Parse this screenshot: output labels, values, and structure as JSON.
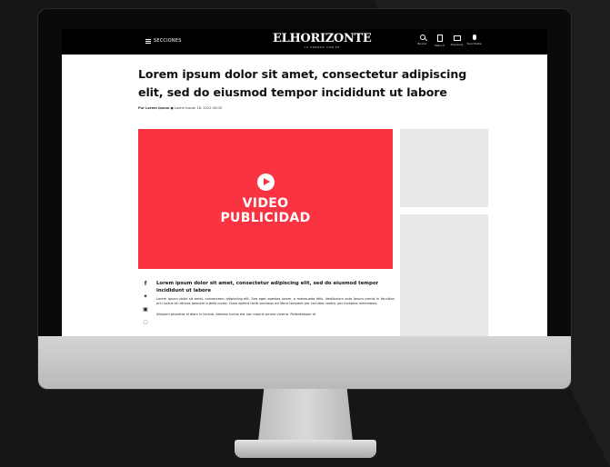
{
  "header": {
    "sections_label": "SECCIONES",
    "logo": "ELHORIZONTE",
    "logo_tagline": "LA VERDAD CON FE",
    "actions": [
      {
        "icon": "search-icon",
        "label": "Buscar"
      },
      {
        "icon": "newspaper-icon",
        "label": "Plano E"
      },
      {
        "icon": "print-icon",
        "label": "Impresos"
      },
      {
        "icon": "microphone-icon",
        "label": "Suscribete"
      }
    ]
  },
  "article": {
    "headline": "Lorem ipsum dolor sit amet, consectetur adipiscing elit, sed do eiusmod tempor incididunt ut labore",
    "byline_prefix": "Por Lorem Ipsum",
    "byline_date": "Lorem Ipsum 18, 2022 00:00",
    "lead": "Lorem ipsum dolor sit amet, consectetur adipiscing elit, sed do eiusmod tempor incididunt ut labore",
    "paragraph": "Lorem ipsum dolor sit amet, consectetur adipiscing elit. Sed eget egestas lorem, a malesuada felis. Vestibulum ante ipsum primis in faucibus orci luctus et ultrices posuere cubilia curae; Class aptent taciti sociosqu ad litora torquent per conubia nostra, per inceptos himenaeos.",
    "paragraph2": "Aliquam pharetra id diam in lacinia. Aenean luctus est nec mauris ornare viverra. Pellentesque id"
  },
  "video_ad": {
    "line1": "VIDEO",
    "line2": "PUBLICIDAD",
    "color": "#fa3343"
  },
  "share_icons": [
    "facebook-icon",
    "twitter-icon",
    "linkedin-icon",
    "whatsapp-icon"
  ]
}
